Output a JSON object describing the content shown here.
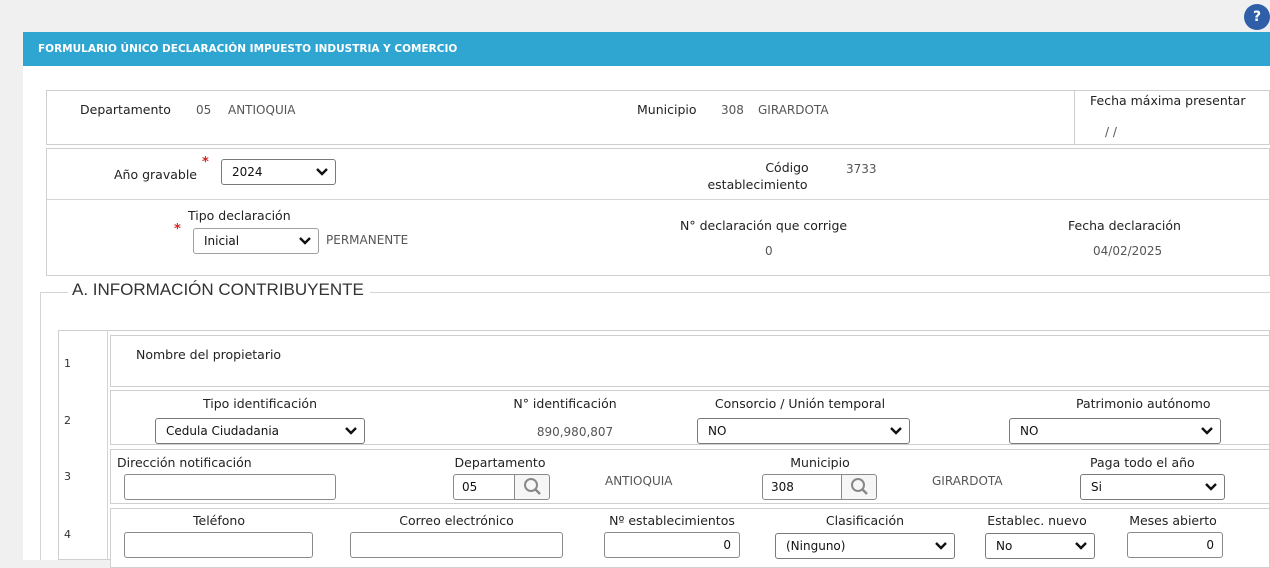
{
  "form": {
    "title": "FORMULARIO ÚNICO DECLARACIÓN IMPUESTO INDUSTRIA Y COMERCIO",
    "help_icon": "question-icon",
    "accent_color": "#2fa6d2"
  },
  "header": {
    "departamento_label": "Departamento",
    "departamento_code": "05",
    "departamento_name": "ANTIOQUIA",
    "municipio_label": "Municipio",
    "municipio_code": "308",
    "municipio_name": "GIRARDOTA",
    "fecha_max_label": "Fecha máxima presentar",
    "fecha_max_value": "/ /"
  },
  "periodo": {
    "anio_label": "Año gravable",
    "anio_value": "2024",
    "codigo_label_1": "Código",
    "codigo_label_2": "establecimiento",
    "codigo_value": "3733"
  },
  "declaracion": {
    "tipo_label": "Tipo declaración",
    "tipo_value": "Inicial",
    "tipo_extra": "PERMANENTE",
    "corrige_label": "N° declaración que corrige",
    "corrige_value": "0",
    "fecha_label": "Fecha declaración",
    "fecha_value": "04/02/2025"
  },
  "section_a": {
    "legend": "A. INFORMACIÓN CONTRIBUYENTE",
    "row1": {
      "num": "1",
      "propietario_label": "Nombre del propietario"
    },
    "row2": {
      "num": "2",
      "tipo_id_label": "Tipo identificación",
      "tipo_id_value": "Cedula Ciudadania",
      "num_id_label": "N° identificación",
      "num_id_value": "890,980,807",
      "consorcio_label": "Consorcio / Unión temporal",
      "consorcio_value": "NO",
      "patrimonio_label": "Patrimonio autónomo",
      "patrimonio_value": "NO"
    },
    "row3": {
      "num": "3",
      "direccion_label": "Dirección notificación",
      "direccion_value": "",
      "depto_label": "Departamento",
      "depto_code": "05",
      "depto_name": "ANTIOQUIA",
      "muni_label": "Municipio",
      "muni_code": "308",
      "muni_name": "GIRARDOTA",
      "paga_label": "Paga todo el año",
      "paga_value": "Si"
    },
    "row4": {
      "num": "4",
      "telefono_label": "Teléfono",
      "telefono_value": "",
      "correo_label": "Correo electrónico",
      "correo_value": "",
      "nest_label": "Nº establecimientos",
      "nest_value": "0",
      "clasif_label": "Clasificación",
      "clasif_value": "(Ninguno)",
      "nuevo_label": "Establec. nuevo",
      "nuevo_value": "No",
      "meses_label": "Meses abierto",
      "meses_value": "0"
    }
  }
}
